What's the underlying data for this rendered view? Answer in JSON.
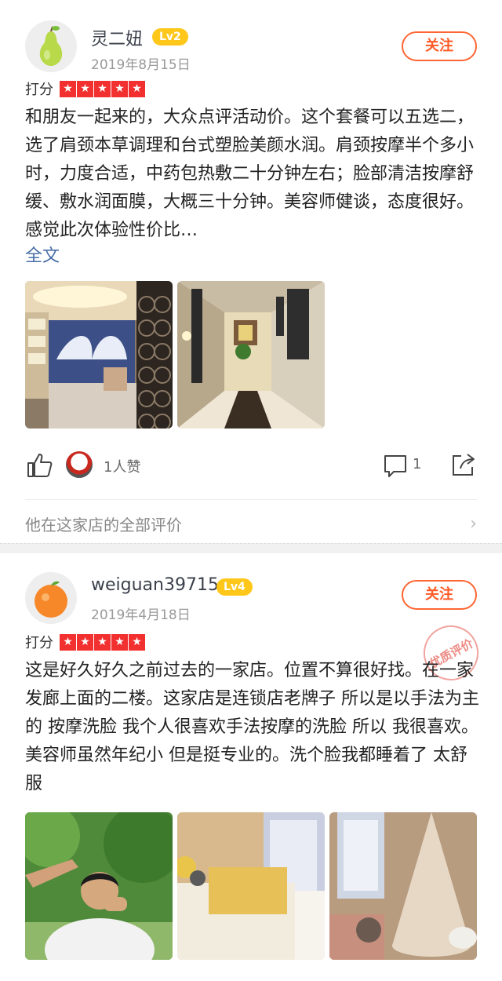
{
  "reviews": [
    {
      "username": "灵二妞",
      "level": "Lv2",
      "date": "2019年8月15日",
      "follow_label": "关注",
      "rating_label": "打分",
      "text": "和朋友一起来的，大众点评活动价。这个套餐可以五选二，选了肩颈本草调理和台式塑脸美颜水润。肩颈按摩半个多小时，力度合适，中药包热敷二十分钟左右；脸部清洁按摩舒缓、敷水润面膜，大概三十分钟。美容师健谈，态度很好。感觉此次体验性价比…",
      "more_label": "全文",
      "likes_text": "1人赞",
      "comment_count": "1",
      "all_reviews_label": "他在这家店的全部评价"
    },
    {
      "username": "weiguan39715",
      "level": "Lv4",
      "date": "2019年4月18日",
      "follow_label": "关注",
      "rating_label": "打分",
      "stamp_text": "优质评价",
      "text": "这是好久好久之前过去的一家店。位置不算很好找。在一家发廊上面的二楼。这家店是连锁店老牌子 所以是以手法为主的 按摩洗脸 我个人很喜欢手法按摩的洗脸 所以 我很喜欢。美容师虽然年纪小 但是挺专业的。洗个脸我都睡着了 太舒服"
    }
  ],
  "colors": {
    "accent": "#ff5a26",
    "level_badge": "#ffc71a",
    "star": "#f23030",
    "link": "#4a6fa8"
  },
  "icons": [
    "pear-avatar-icon",
    "orange-avatar-icon",
    "thumbs-up-icon",
    "comment-icon",
    "share-icon",
    "chevron-right-icon"
  ]
}
